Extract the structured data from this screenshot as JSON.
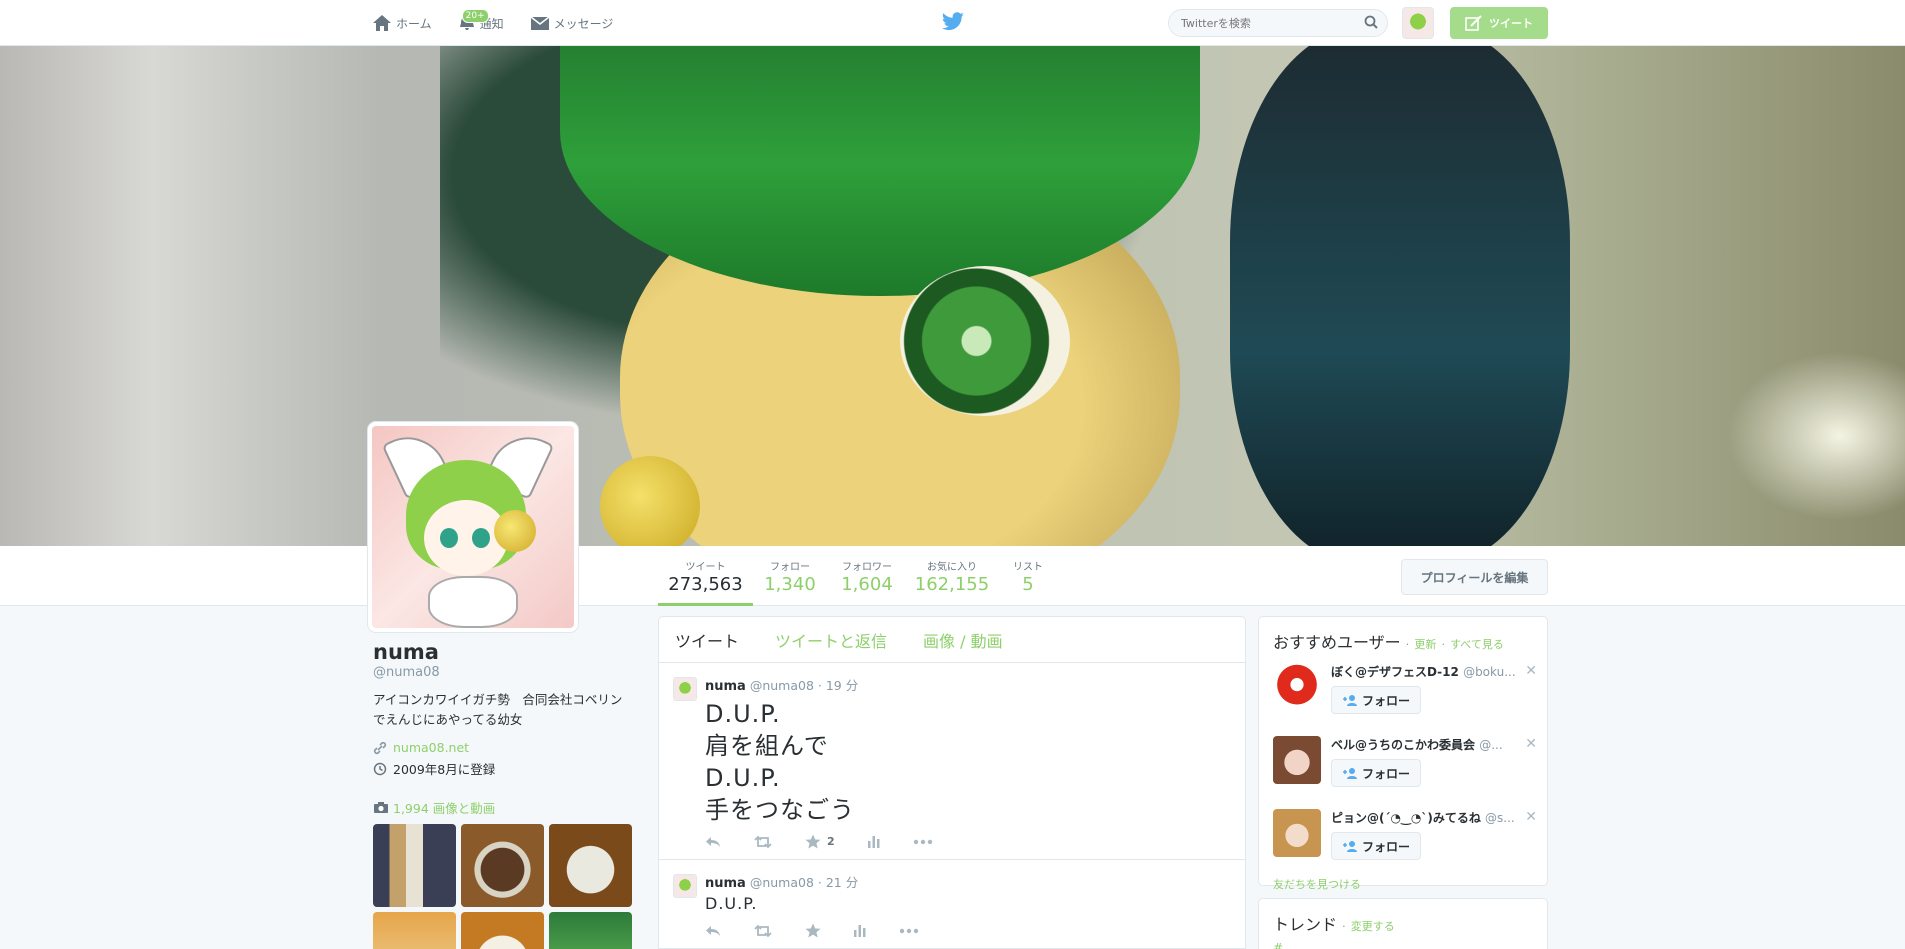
{
  "nav": {
    "home": "ホーム",
    "notifications": "通知",
    "notifications_badge": "20+",
    "messages": "メッセージ",
    "search_placeholder": "Twitterを検索",
    "tweet_button": "ツイート"
  },
  "colors": {
    "accent": "#8dd06b",
    "accent_light": "#a5dc8b",
    "bird": "#55acee"
  },
  "profile": {
    "name": "numa",
    "handle": "@numa08",
    "bio": "アイコンカワイイガチ勢　合同会社コベリンでえんじにあやってる幼女",
    "website": "numa08.net",
    "joined": "2009年8月に登録",
    "media_label": "1,994 画像と動画"
  },
  "stats": [
    {
      "label": "ツイート",
      "value": "273,563"
    },
    {
      "label": "フォロー",
      "value": "1,340"
    },
    {
      "label": "フォロワー",
      "value": "1,604"
    },
    {
      "label": "お気に入り",
      "value": "162,155"
    },
    {
      "label": "リスト",
      "value": "5"
    }
  ],
  "edit_profile": "プロフィールを編集",
  "tabs": [
    "ツイート",
    "ツイートと返信",
    "画像 / 動画"
  ],
  "tweets": [
    {
      "name": "numa",
      "handle": "@numa08",
      "time": "· 19 分",
      "lines": [
        "D.U.P.",
        "肩を組んで",
        "D.U.P.",
        "手をつなごう"
      ],
      "favorites": "2"
    },
    {
      "name": "numa",
      "handle": "@numa08",
      "time": "· 21 分",
      "lines": [
        "D.U.P."
      ],
      "favorites": ""
    }
  ],
  "who_to_follow": {
    "title": "おすすめユーザー",
    "refresh": "更新",
    "view_all": "すべて見る",
    "separator": "·",
    "users": [
      {
        "name": "ぼく@デザフェスD-12",
        "handle": "@boku...",
        "follow": "フォロー"
      },
      {
        "name": "ベル@うちのこかわ委員会",
        "handle": "@...",
        "follow": "フォロー"
      },
      {
        "name": "ピョン@(´◔‿◔`)みてるね",
        "handle": "@s...",
        "follow": "フォロー"
      }
    ],
    "find_friends": "友だちを見つける"
  },
  "trends": {
    "title": "トレンド",
    "change": "変更する",
    "separator": "·",
    "first": "#..."
  }
}
